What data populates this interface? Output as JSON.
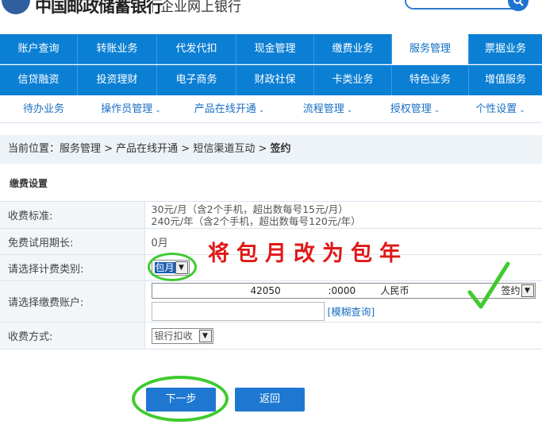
{
  "header": {
    "bank_name": "中国邮政储蓄银行",
    "subtitle": "企业网上银行",
    "search_placeholder": ""
  },
  "nav_row1": [
    "账户查询",
    "转账业务",
    "代发代扣",
    "现金管理",
    "缴费业务",
    "服务管理",
    "票据业务"
  ],
  "nav_row2": [
    "信贷融资",
    "投资理财",
    "电子商务",
    "财政社保",
    "卡类业务",
    "特色业务",
    "增值服务"
  ],
  "active_nav": "服务管理",
  "sub_nav": [
    "待办业务",
    "操作员管理",
    "产品在线开通",
    "流程管理",
    "授权管理",
    "个性设置"
  ],
  "breadcrumb": {
    "prefix": "当前位置：",
    "path": "服务管理 > 产品在线开通 > 短信渠道互动 > ",
    "current": "签约"
  },
  "section_title": "缴费设置",
  "form": {
    "fee_standard_label": "收费标准:",
    "fee_standard_line1": "30元/月（含2个手机，超出数每号15元/月）",
    "fee_standard_line2": "240元/年（含2个手机，超出数每号120元/年）",
    "trial_label": "免费试用期长:",
    "trial_value": "0月",
    "billing_type_label": "请选择计费类别:",
    "billing_type_value": "包月",
    "account_label": "请选择缴费账户:",
    "account_value_part1": "42050",
    "account_value_part2": ":0000",
    "account_currency": "人民币",
    "account_status": "签约",
    "account_input_value": "",
    "fuzzy_search": "[模糊查询]",
    "method_label": "收费方式:",
    "method_value": "银行扣收"
  },
  "buttons": {
    "next": "下一步",
    "back": "返回"
  },
  "annotation_text": "将包月改为包年",
  "colors": {
    "nav_blue": "#0b7fd4",
    "link_blue": "#1a6fc4",
    "annotation_red": "#e01818",
    "marker_green": "#3ecb2e"
  }
}
